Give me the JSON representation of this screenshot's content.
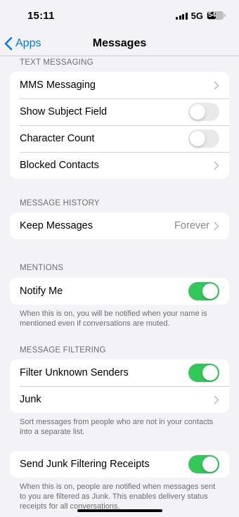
{
  "status": {
    "time": "15:11",
    "network": "5G",
    "battery": "54"
  },
  "nav": {
    "back_label": "Apps",
    "title": "Messages"
  },
  "sections": {
    "text_messaging": {
      "header": "TEXT MESSAGING",
      "mms": "MMS Messaging",
      "subject": "Show Subject Field",
      "char_count": "Character Count",
      "blocked": "Blocked Contacts"
    },
    "history": {
      "header": "MESSAGE HISTORY",
      "keep_label": "Keep Messages",
      "keep_value": "Forever"
    },
    "mentions": {
      "header": "MENTIONS",
      "notify_label": "Notify Me",
      "footer": "When this is on, you will be notified when your name is mentioned even if conversations are muted."
    },
    "filtering": {
      "header": "MESSAGE FILTERING",
      "filter_label": "Filter Unknown Senders",
      "junk_label": "Junk",
      "footer": "Sort messages from people who are not in your contacts into a separate list."
    },
    "receipts": {
      "label": "Send Junk Filtering Receipts",
      "footer": "When this is on, people are notified when messages sent to you are filtered as Junk. This enables delivery status receipts for all conversations."
    }
  },
  "toggles": {
    "subject_on": false,
    "char_count_on": false,
    "notify_on": true,
    "filter_on": true,
    "receipts_on": true
  },
  "colors": {
    "accent": "#007aff",
    "toggle_on": "#34c759",
    "background": "#f2f2f7"
  }
}
